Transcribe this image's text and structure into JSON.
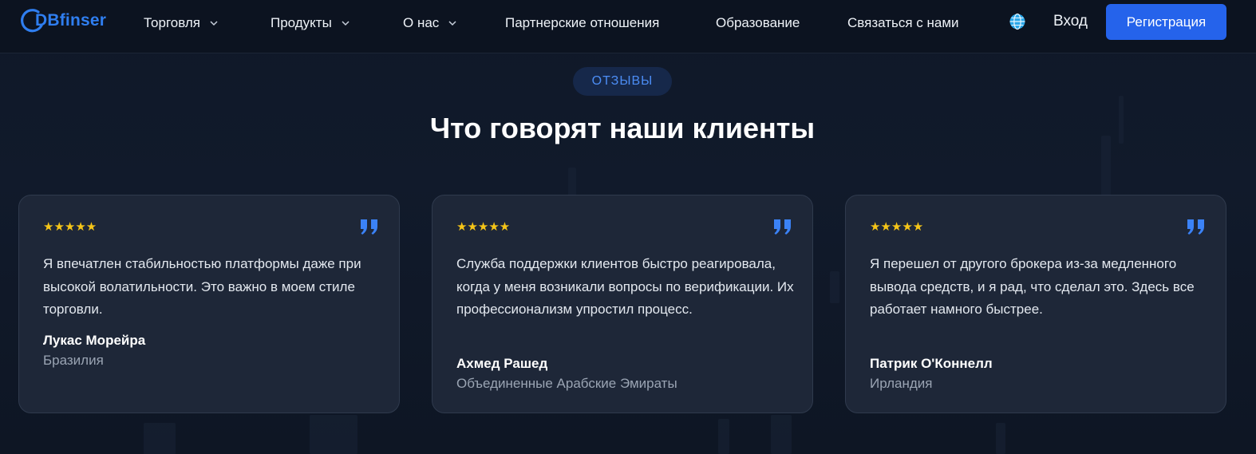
{
  "brand": {
    "logo_text": "DBfinser",
    "accent_color": "#2563eb"
  },
  "nav": {
    "items": [
      {
        "label": "Торговля",
        "has_dropdown": true
      },
      {
        "label": "Продукты",
        "has_dropdown": true
      },
      {
        "label": "О нас",
        "has_dropdown": true
      },
      {
        "label": "Партнерские отношения",
        "has_dropdown": false
      },
      {
        "label": "Образование",
        "has_dropdown": false
      },
      {
        "label": "Связаться с нами",
        "has_dropdown": false
      }
    ],
    "language_icon": "globe-icon",
    "login_label": "Вход",
    "register_label": "Регистрация"
  },
  "section": {
    "badge": "ОТЗЫВЫ",
    "title": "Что говорят наши клиенты"
  },
  "testimonials": [
    {
      "stars": "★★★★★",
      "rating": 5,
      "text": "Я впечатлен стабильностью платформы даже при высокой волатильности. Это важно в моем стиле торговли.",
      "author": "Лукас Морейра",
      "country": "Бразилия"
    },
    {
      "stars": "★★★★★",
      "rating": 5,
      "text": "Служба поддержки клиентов быстро реагировала, когда у меня возникали вопросы по верификации. Их профессионализм упростил процесс.",
      "author": "Ахмед Рашед",
      "country": "Объединенные Арабские Эмираты"
    },
    {
      "stars": "★★★★★",
      "rating": 5,
      "text": "Я перешел от другого брокера из-за медленного вывода средств, и я рад, что сделал это. Здесь все работает намного быстрее.",
      "author": "Патрик О'Коннелл",
      "country": "Ирландия"
    }
  ],
  "colors": {
    "star": "#f5c518",
    "quote": "#3b82f6",
    "card_bg": "#1e2738",
    "muted_text": "#9aa4b3"
  }
}
